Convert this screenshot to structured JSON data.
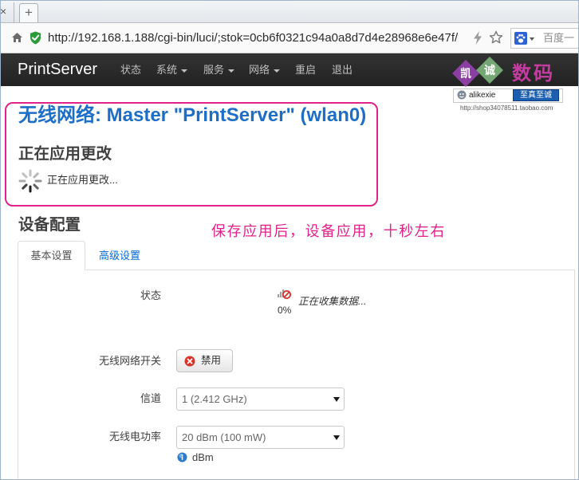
{
  "browser": {
    "prev_tab_close": "×",
    "new_tab": "+",
    "url": "http://192.168.1.188/cgi-bin/luci/;stok=0cb6f0321c94a0a8d7d4e28968e6e47f/",
    "search_text": "百度一",
    "icons": {
      "home": "home-icon",
      "secure": "secure-shield-icon",
      "lightning": "lightning-icon",
      "star": "bookmark-star-icon",
      "search_engine": "baidu-paw-icon"
    }
  },
  "nav": {
    "brand": "PrintServer",
    "items": [
      {
        "label": "状态",
        "dropdown": false
      },
      {
        "label": "系统",
        "dropdown": true
      },
      {
        "label": "服务",
        "dropdown": true
      },
      {
        "label": "网络",
        "dropdown": true
      },
      {
        "label": "重启",
        "dropdown": false
      },
      {
        "label": "退出",
        "dropdown": false
      }
    ]
  },
  "watermark": {
    "char1": "凯",
    "char2": "诚",
    "brand": "数码",
    "user": "alikexie",
    "slogan": "至真至诚",
    "shop_url": "http://shop34078511.taobao.com"
  },
  "page": {
    "title": "无线网络: Master \"PrintServer\" (wlan0)",
    "applying": {
      "heading": "正在应用更改",
      "message": "正在应用更改..."
    },
    "section_title": "设备配置",
    "annotation": "保存应用后，设备应用，十秒左右",
    "tabs": [
      {
        "label": "基本设置",
        "active": true
      },
      {
        "label": "高级设置",
        "active": false
      }
    ],
    "fields": {
      "status": {
        "label": "状态",
        "signal": "0%",
        "text": "正在收集数据..."
      },
      "wifi_switch": {
        "label": "无线网络开关",
        "button": "禁用"
      },
      "channel": {
        "label": "信道",
        "value": "1 (2.412 GHz)"
      },
      "txpower": {
        "label": "无线电功率",
        "value": "20 dBm (100 mW)",
        "hint": "dBm"
      }
    }
  },
  "colors": {
    "navbar": "#222222",
    "title": "#1c6ec6",
    "link": "#0069d6",
    "annotation": "#e0228a",
    "watermark_purple": "#8b3fa3",
    "watermark_green": "#74a774",
    "watermark_magenta": "#c43c9f",
    "watermark_slogan": "#1c5fb0"
  }
}
